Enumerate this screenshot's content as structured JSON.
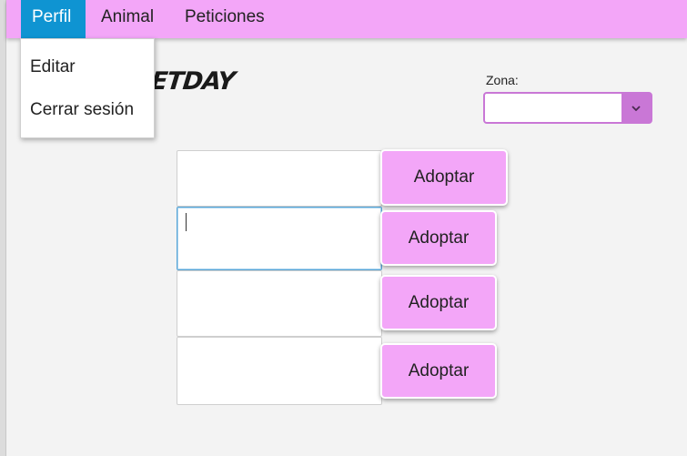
{
  "menubar": {
    "items": [
      {
        "label": "Perfil",
        "active": true
      },
      {
        "label": "Animal",
        "active": false
      },
      {
        "label": "Peticiones",
        "active": false
      }
    ]
  },
  "profile_menu": {
    "items": [
      {
        "label": "Editar"
      },
      {
        "label": "Cerrar sesión"
      }
    ]
  },
  "logo": {
    "text": "ETDAY"
  },
  "zona": {
    "label": "Zona:",
    "value": ""
  },
  "pets": [
    {
      "name": "",
      "button_label": "Adoptar"
    },
    {
      "name": "",
      "button_label": "Adoptar",
      "focused": true
    },
    {
      "name": "",
      "button_label": "Adoptar"
    },
    {
      "name": "",
      "button_label": "Adoptar"
    }
  ],
  "colors": {
    "menubar": "#f3a6f8",
    "menu_active": "#0f94d2",
    "button": "#f3a6f8",
    "select_accent": "#c977d6"
  }
}
